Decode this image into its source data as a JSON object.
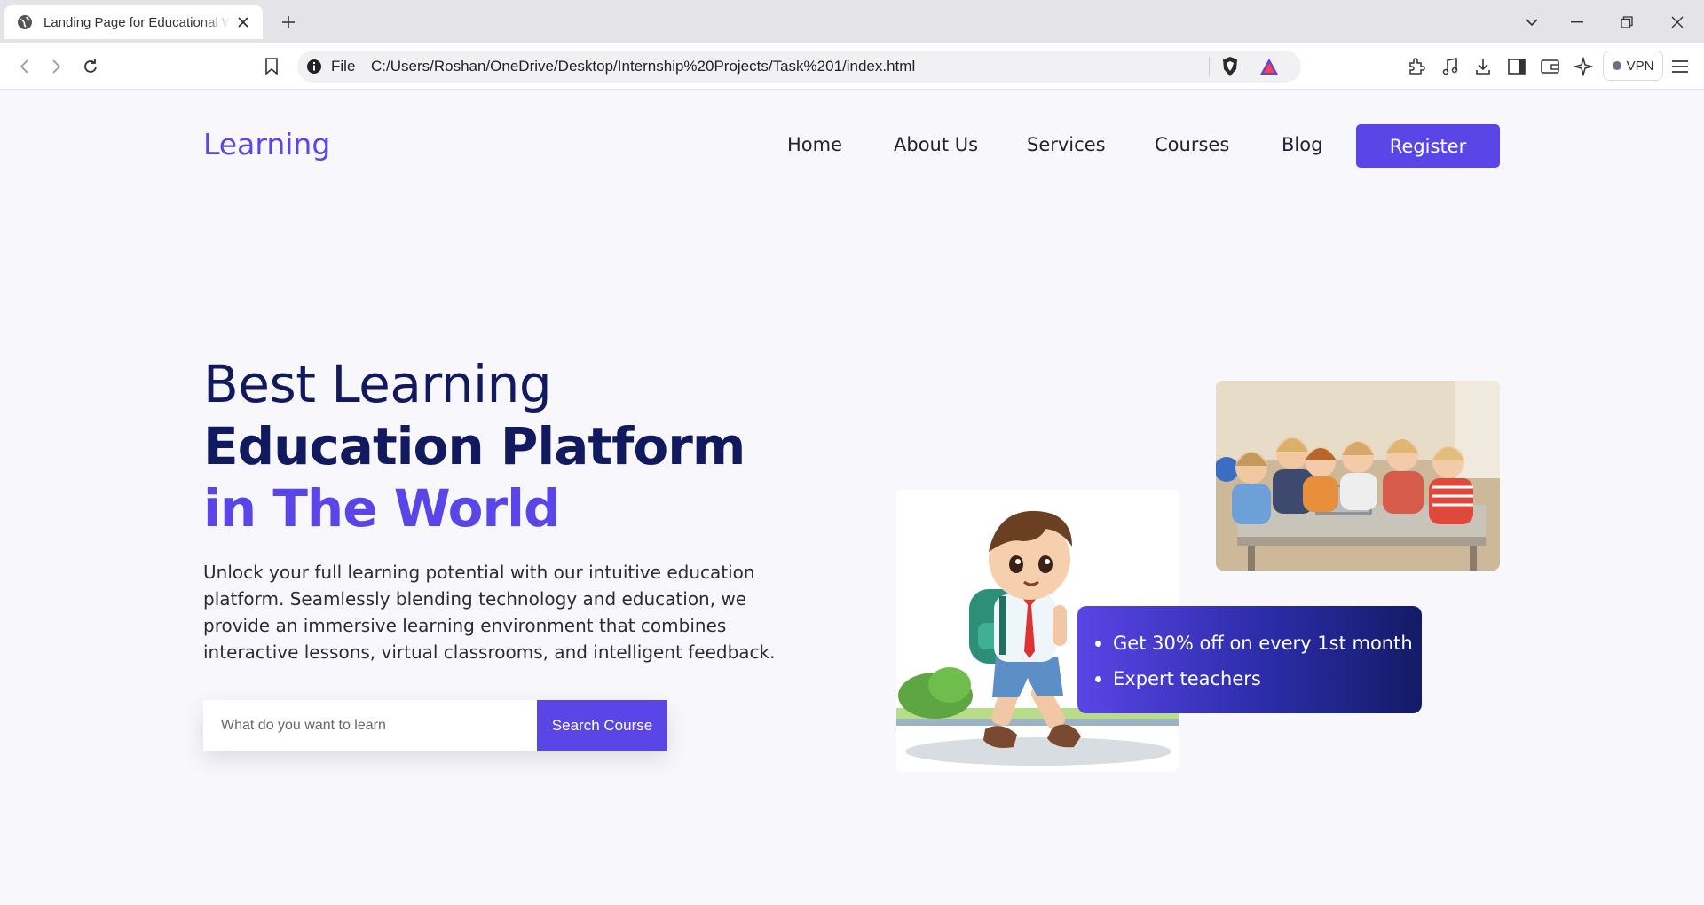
{
  "browser": {
    "tab_title": "Landing Page for Educational Website",
    "address_scheme_label": "File",
    "url": "C:/Users/Roshan/OneDrive/Desktop/Internship%20Projects/Task%201/index.html",
    "vpn_label": "VPN"
  },
  "site": {
    "logo": "Learning",
    "nav": [
      "Home",
      "About Us",
      "Services",
      "Courses",
      "Blog"
    ],
    "register_label": "Register"
  },
  "hero": {
    "line1": "Best Learning",
    "line2": "Education Platform",
    "line3": "in The World",
    "description": "Unlock your full learning potential with our intuitive education platform. Seamlessly blending technology and education, we provide an immersive learning environment that combines interactive lessons, virtual classrooms, and intelligent feedback.",
    "search_placeholder": "What do you want to learn",
    "search_button": "Search Course"
  },
  "features": [
    "Get 30% off on every 1st month",
    "Expert teachers"
  ],
  "colors": {
    "brand": "#5a45e6",
    "heading": "#111a5e",
    "background": "#f8f8fc"
  }
}
